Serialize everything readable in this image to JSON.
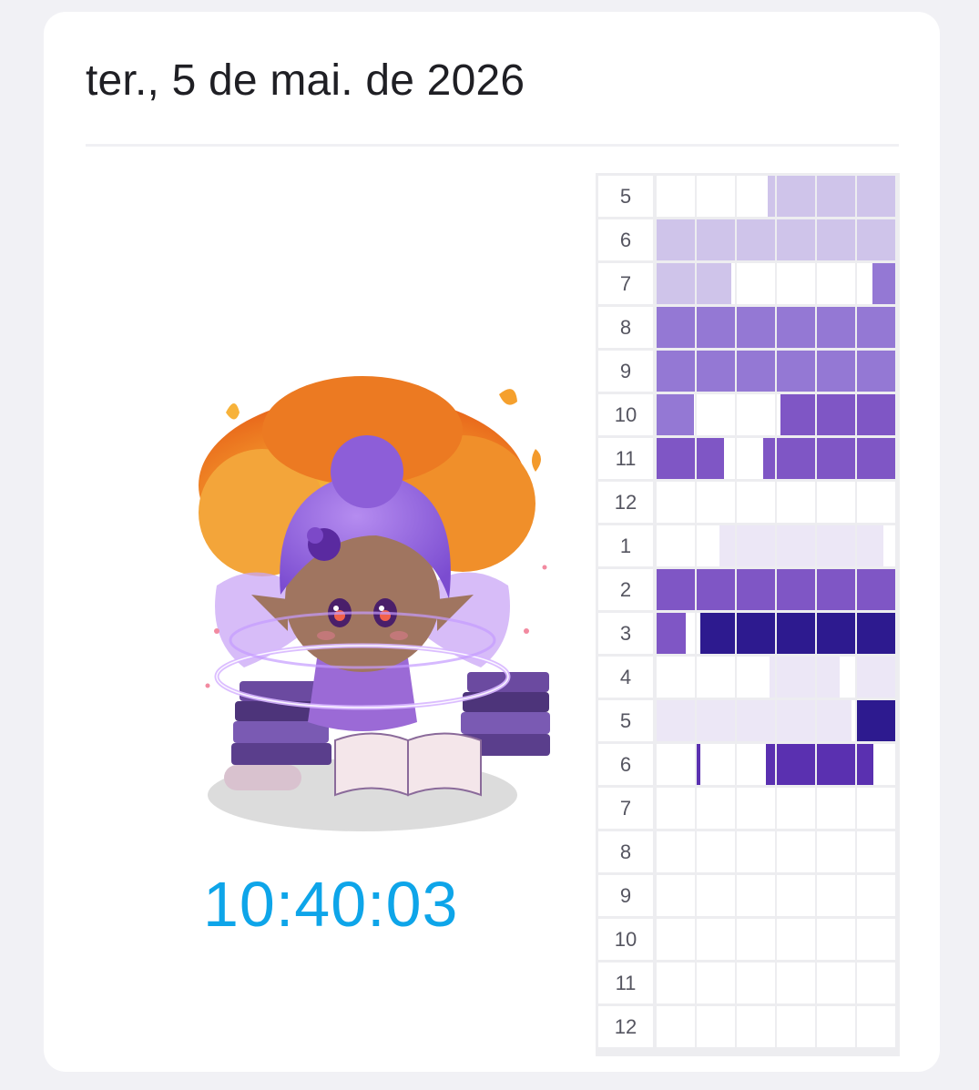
{
  "date": "ter., 5 de mai. de 2026",
  "clock": "10:40:03",
  "illustration": {
    "description_icon": "fairy-reading-books-icon"
  },
  "colors": {
    "level1": "#ece7f6",
    "level2": "#cfc4ea",
    "level3": "#9478d4",
    "level4": "#7f56c5",
    "level5": "#5a30b0",
    "level6": "#2d1a8f"
  },
  "hour_grid": {
    "columns_per_row": 6,
    "rows": [
      {
        "label": "5",
        "cells": [
          [
            0,
            0,
            0
          ],
          [
            0,
            0,
            0
          ],
          [
            0.8,
            1,
            2
          ],
          [
            0,
            1,
            2
          ],
          [
            0,
            1,
            2
          ],
          [
            0,
            1,
            2
          ]
        ]
      },
      {
        "label": "6",
        "cells": [
          [
            0,
            1,
            2
          ],
          [
            0,
            1,
            2
          ],
          [
            0,
            1,
            2
          ],
          [
            0,
            1,
            2
          ],
          [
            0,
            1,
            2
          ],
          [
            0,
            1,
            2
          ]
        ]
      },
      {
        "label": "7",
        "cells": [
          [
            0,
            1,
            2
          ],
          [
            0,
            0.9,
            2
          ],
          [
            0,
            0,
            0
          ],
          [
            0,
            0,
            0
          ],
          [
            0,
            0,
            0
          ],
          [
            0.4,
            1,
            3
          ]
        ]
      },
      {
        "label": "8",
        "cells": [
          [
            0,
            1,
            3
          ],
          [
            0,
            1,
            3
          ],
          [
            0,
            1,
            3
          ],
          [
            0,
            1,
            3
          ],
          [
            0,
            1,
            3
          ],
          [
            0,
            1,
            3
          ]
        ]
      },
      {
        "label": "9",
        "cells": [
          [
            0,
            1,
            3
          ],
          [
            0,
            1,
            3
          ],
          [
            0,
            1,
            3
          ],
          [
            0,
            1,
            3
          ],
          [
            0,
            1,
            3
          ],
          [
            0,
            1,
            3
          ]
        ]
      },
      {
        "label": "10",
        "cells": [
          [
            0,
            0.97,
            3
          ],
          [
            0,
            0,
            0
          ],
          [
            0,
            0,
            0
          ],
          [
            0.1,
            1,
            4
          ],
          [
            0,
            1,
            4
          ],
          [
            0,
            1,
            4
          ]
        ]
      },
      {
        "label": "11",
        "cells": [
          [
            0,
            1,
            4
          ],
          [
            0,
            0.72,
            4
          ],
          [
            0.7,
            1,
            4
          ],
          [
            0,
            1,
            4
          ],
          [
            0,
            1,
            4
          ],
          [
            0,
            1,
            4
          ]
        ]
      },
      {
        "label": "12",
        "cells": [
          [
            0,
            0,
            0
          ],
          [
            0,
            0,
            0
          ],
          [
            0,
            0,
            0
          ],
          [
            0,
            0,
            0
          ],
          [
            0,
            0,
            0
          ],
          [
            0,
            0,
            0
          ]
        ]
      },
      {
        "label": "1",
        "cells": [
          [
            0,
            0,
            0
          ],
          [
            0.6,
            1,
            1
          ],
          [
            0,
            1,
            1
          ],
          [
            0,
            1,
            1
          ],
          [
            0,
            1,
            1
          ],
          [
            0,
            0.7,
            1
          ]
        ]
      },
      {
        "label": "2",
        "cells": [
          [
            0,
            1,
            4
          ],
          [
            0,
            1,
            4
          ],
          [
            0,
            1,
            4
          ],
          [
            0,
            1,
            4
          ],
          [
            0,
            1,
            4
          ],
          [
            0,
            1,
            4
          ]
        ]
      },
      {
        "label": "3",
        "cells": [
          [
            0,
            0.75,
            4
          ],
          [
            0.1,
            1,
            6
          ],
          [
            0,
            1,
            6
          ],
          [
            0,
            1,
            6
          ],
          [
            0,
            1,
            6
          ],
          [
            0,
            1,
            6
          ]
        ]
      },
      {
        "label": "4",
        "cells": [
          [
            0,
            0,
            0
          ],
          [
            0,
            0,
            0
          ],
          [
            0.85,
            1,
            1
          ],
          [
            0,
            1,
            1
          ],
          [
            0,
            0.6,
            1
          ],
          [
            0,
            1,
            1
          ]
        ]
      },
      {
        "label": "5",
        "cells": [
          [
            0,
            1,
            1
          ],
          [
            0,
            1,
            1
          ],
          [
            0,
            1,
            1
          ],
          [
            0,
            1,
            1
          ],
          [
            0,
            0.9,
            1
          ],
          [
            0,
            1,
            6
          ]
        ]
      },
      {
        "label": "6",
        "cells": [
          [
            0,
            0,
            0
          ],
          [
            0,
            0.1,
            5
          ],
          [
            0.75,
            1,
            5
          ],
          [
            0,
            1,
            5
          ],
          [
            0,
            1,
            5
          ],
          [
            0,
            0.42,
            5
          ]
        ]
      },
      {
        "label": "7",
        "cells": [
          [
            0,
            0,
            0
          ],
          [
            0,
            0,
            0
          ],
          [
            0,
            0,
            0
          ],
          [
            0,
            0,
            0
          ],
          [
            0,
            0,
            0
          ],
          [
            0,
            0,
            0
          ]
        ]
      },
      {
        "label": "8",
        "cells": [
          [
            0,
            0,
            0
          ],
          [
            0,
            0,
            0
          ],
          [
            0,
            0,
            0
          ],
          [
            0,
            0,
            0
          ],
          [
            0,
            0,
            0
          ],
          [
            0,
            0,
            0
          ]
        ]
      },
      {
        "label": "9",
        "cells": [
          [
            0,
            0,
            0
          ],
          [
            0,
            0,
            0
          ],
          [
            0,
            0,
            0
          ],
          [
            0,
            0,
            0
          ],
          [
            0,
            0,
            0
          ],
          [
            0,
            0,
            0
          ]
        ]
      },
      {
        "label": "10",
        "cells": [
          [
            0,
            0,
            0
          ],
          [
            0,
            0,
            0
          ],
          [
            0,
            0,
            0
          ],
          [
            0,
            0,
            0
          ],
          [
            0,
            0,
            0
          ],
          [
            0,
            0,
            0
          ]
        ]
      },
      {
        "label": "11",
        "cells": [
          [
            0,
            0,
            0
          ],
          [
            0,
            0,
            0
          ],
          [
            0,
            0,
            0
          ],
          [
            0,
            0,
            0
          ],
          [
            0,
            0,
            0
          ],
          [
            0,
            0,
            0
          ]
        ]
      },
      {
        "label": "12",
        "cells": [
          [
            0,
            0,
            0
          ],
          [
            0,
            0,
            0
          ],
          [
            0,
            0,
            0
          ],
          [
            0,
            0,
            0
          ],
          [
            0,
            0,
            0
          ],
          [
            0,
            0,
            0
          ]
        ]
      }
    ]
  }
}
